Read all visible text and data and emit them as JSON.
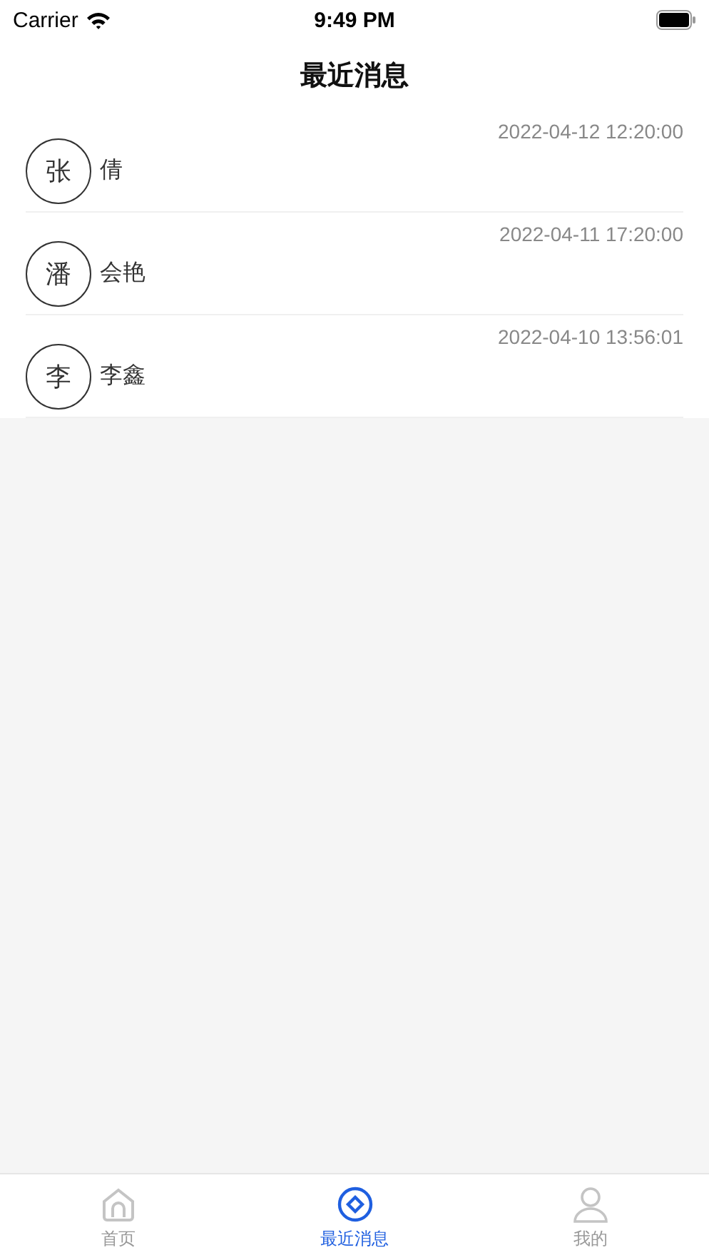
{
  "status_bar": {
    "carrier": "Carrier",
    "time": "9:49 PM"
  },
  "title": "最近消息",
  "messages": [
    {
      "avatar": "张",
      "name": "倩",
      "time": "2022-04-12 12:20:00"
    },
    {
      "avatar": "潘",
      "name": "会艳",
      "time": "2022-04-11 17:20:00"
    },
    {
      "avatar": "李",
      "name": "李鑫",
      "time": "2022-04-10 13:56:01"
    }
  ],
  "tabs": [
    {
      "kind": "home",
      "label": "首页",
      "selected": false
    },
    {
      "kind": "messages",
      "label": "最近消息",
      "selected": true
    },
    {
      "kind": "profile",
      "label": "我的",
      "selected": false
    }
  ]
}
